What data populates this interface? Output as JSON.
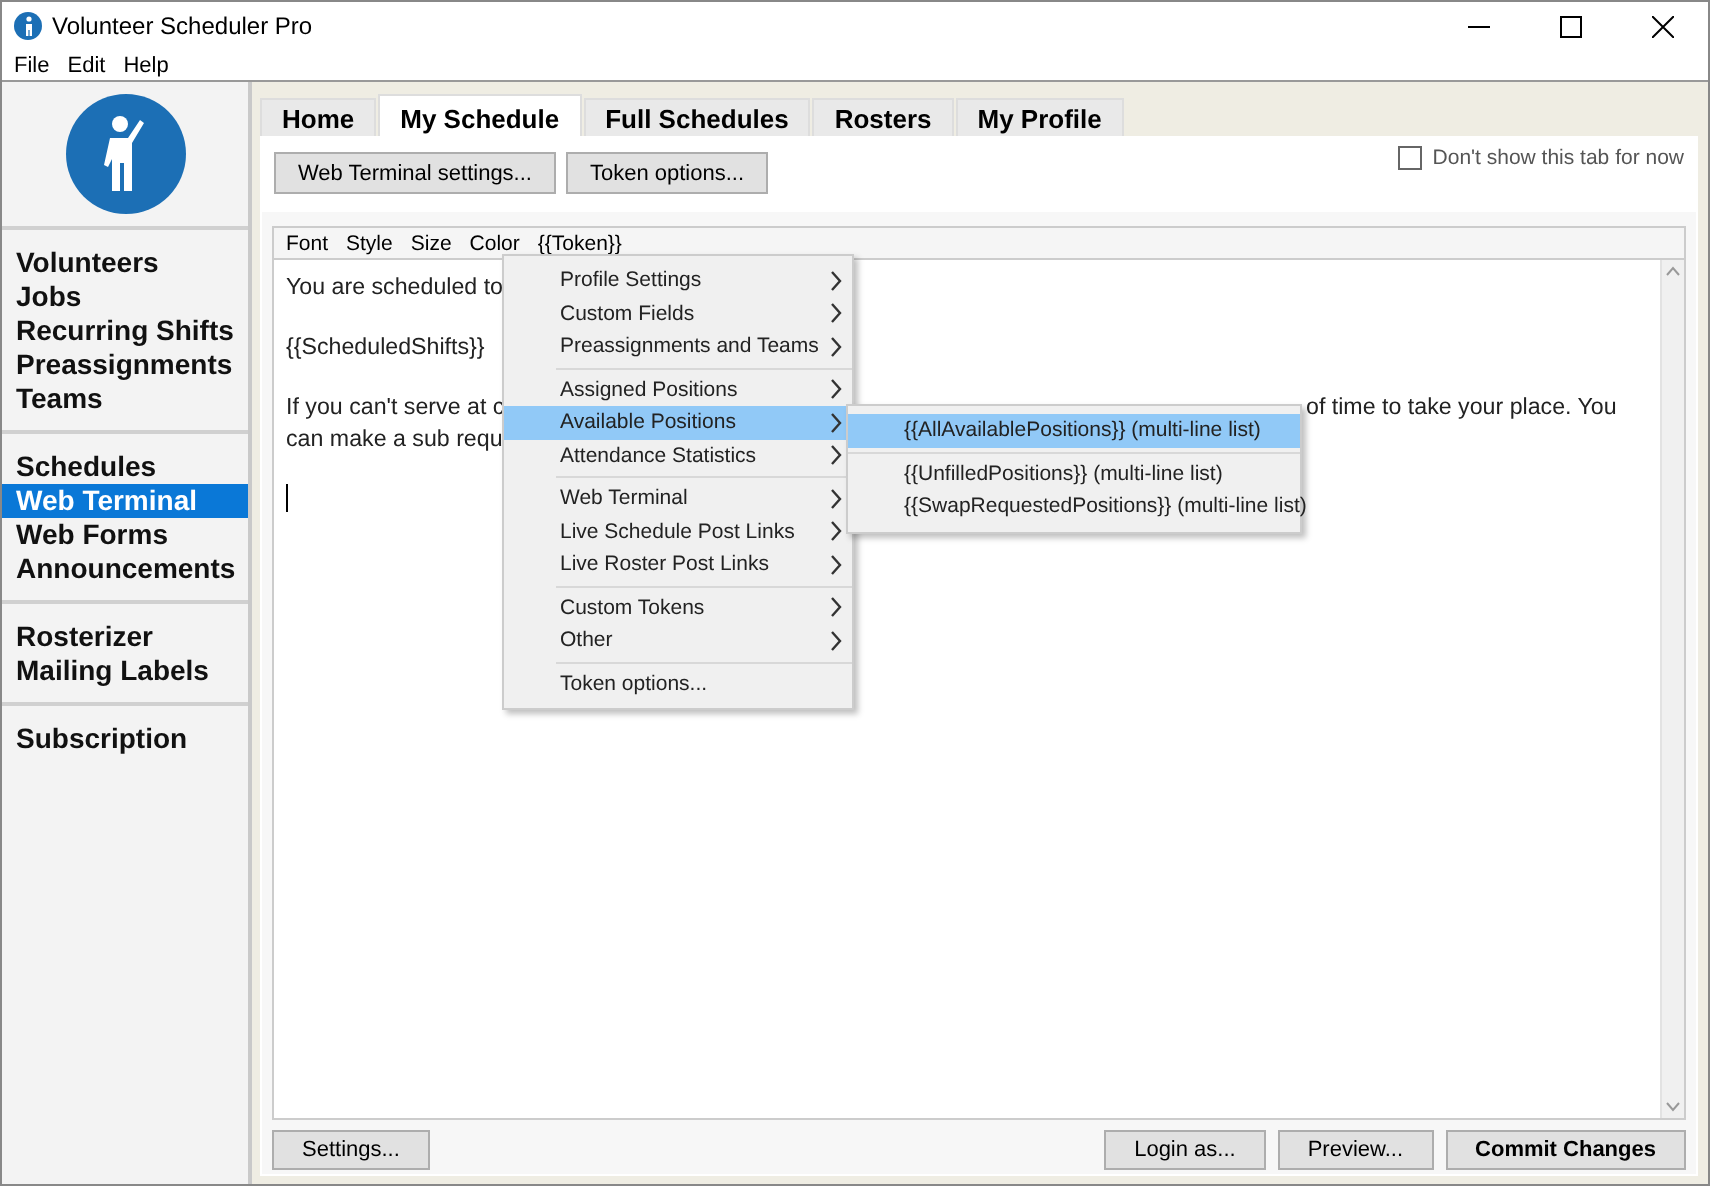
{
  "window": {
    "title": "Volunteer Scheduler Pro"
  },
  "menu_bar": [
    "File",
    "Edit",
    "Help"
  ],
  "sidebar": {
    "groups": [
      [
        {
          "label": "Volunteers",
          "selected": false
        },
        {
          "label": "Jobs",
          "selected": false
        },
        {
          "label": "Recurring Shifts",
          "selected": false
        },
        {
          "label": "Preassignments",
          "selected": false
        },
        {
          "label": "Teams",
          "selected": false
        }
      ],
      [
        {
          "label": "Schedules",
          "selected": false
        },
        {
          "label": "Web Terminal",
          "selected": true
        },
        {
          "label": "Web Forms",
          "selected": false
        },
        {
          "label": "Announcements",
          "selected": false
        }
      ],
      [
        {
          "label": "Rosterizer",
          "selected": false
        },
        {
          "label": "Mailing Labels",
          "selected": false
        }
      ],
      [
        {
          "label": "Subscription",
          "selected": false
        }
      ]
    ]
  },
  "tabs": [
    {
      "label": "Home",
      "selected": false
    },
    {
      "label": "My Schedule",
      "selected": true
    },
    {
      "label": "Full Schedules",
      "selected": false
    },
    {
      "label": "Rosters",
      "selected": false
    },
    {
      "label": "My Profile",
      "selected": false
    }
  ],
  "toolbar": {
    "buttons": [
      "Web Terminal settings...",
      "Token options..."
    ],
    "hide_tab": {
      "label": "Don't show this tab for now",
      "checked": false
    }
  },
  "format_bar": [
    "Font",
    "Style",
    "Size",
    "Color",
    "{{Token}}"
  ],
  "editor": {
    "paragraphs": [
      [
        {
          "text": "You are scheduled to"
        }
      ],
      [
        {
          "text": "{{ScheduledShifts}}"
        }
      ],
      [
        {
          "text": "If you can't serve at c",
          "tail": "of time to take your place. You"
        },
        {
          "text": "can make a sub requ"
        }
      ]
    ]
  },
  "token_menu": {
    "groups": [
      [
        {
          "label": "Profile Settings",
          "submenu": true,
          "selected": false
        },
        {
          "label": "Custom Fields",
          "submenu": true,
          "selected": false
        },
        {
          "label": "Preassignments and Teams",
          "submenu": true,
          "selected": false
        }
      ],
      [
        {
          "label": "Assigned Positions",
          "submenu": true,
          "selected": false
        },
        {
          "label": "Available Positions",
          "submenu": true,
          "selected": true
        },
        {
          "label": "Attendance Statistics",
          "submenu": true,
          "selected": false
        }
      ],
      [
        {
          "label": "Web Terminal",
          "submenu": true,
          "selected": false
        },
        {
          "label": "Live Schedule Post Links",
          "submenu": true,
          "selected": false
        },
        {
          "label": "Live Roster Post Links",
          "submenu": true,
          "selected": false
        }
      ],
      [
        {
          "label": "Custom Tokens",
          "submenu": true,
          "selected": false
        },
        {
          "label": "Other",
          "submenu": true,
          "selected": false
        }
      ],
      [
        {
          "label": "Token options...",
          "submenu": false,
          "selected": false
        }
      ]
    ]
  },
  "submenu": {
    "groups": [
      [
        {
          "label": "{{AllAvailablePositions}} (multi-line list)",
          "selected": true
        }
      ],
      [
        {
          "label": "{{UnfilledPositions}} (multi-line list)",
          "selected": false
        },
        {
          "label": "{{SwapRequestedPositions}} (multi-line list)",
          "selected": false
        }
      ]
    ]
  },
  "footer": {
    "left_buttons": [
      {
        "label": "Settings...",
        "kind": "normal"
      }
    ],
    "right_buttons": [
      {
        "label": "Login as...",
        "kind": "normal"
      },
      {
        "label": "Preview...",
        "kind": "normal"
      },
      {
        "label": "Commit Changes",
        "kind": "primary"
      }
    ]
  }
}
